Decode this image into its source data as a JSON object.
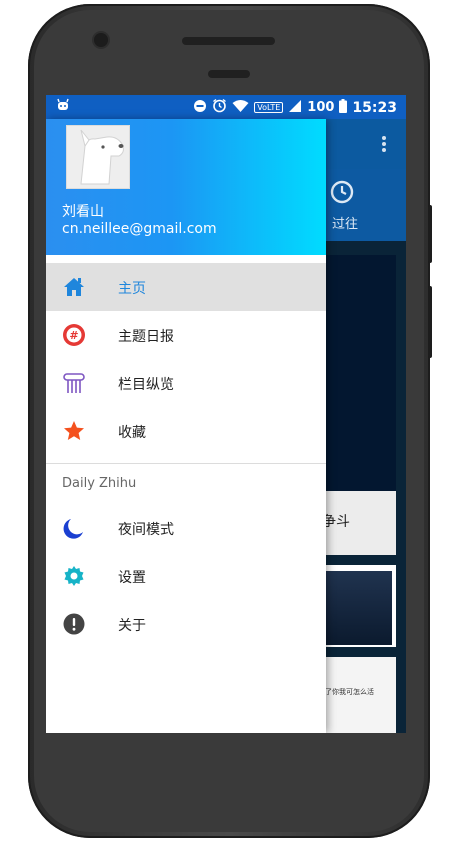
{
  "status_bar": {
    "battery": "100",
    "time": "15:23",
    "network": "VoLTE",
    "icons": [
      "android-icon",
      "dnd-icon",
      "alarm-icon",
      "wifi-icon",
      "signal-icon",
      "battery-icon"
    ]
  },
  "background_app": {
    "tab_past_label": "过往",
    "card_title_fragment": "争斗",
    "card3_text": "没了你我可怎么活"
  },
  "drawer": {
    "user_name": "刘看山",
    "user_email": "cn.neillee@gmail.com",
    "items": [
      {
        "label": "主页",
        "icon": "home-icon",
        "color": "#1f86dc"
      },
      {
        "label": "主题日报",
        "icon": "hashtag-icon",
        "color": "#e53935"
      },
      {
        "label": "栏目纵览",
        "icon": "columns-icon",
        "color": "#7e57c2"
      },
      {
        "label": "收藏",
        "icon": "star-icon",
        "color": "#f4511e"
      }
    ],
    "section_title": "Daily Zhihu",
    "section_items": [
      {
        "label": "夜间模式",
        "icon": "moon-icon",
        "color": "#1a3fd1"
      },
      {
        "label": "设置",
        "icon": "gear-icon",
        "color": "#16b3c7"
      },
      {
        "label": "关于",
        "icon": "info-icon",
        "color": "#444444"
      }
    ]
  }
}
